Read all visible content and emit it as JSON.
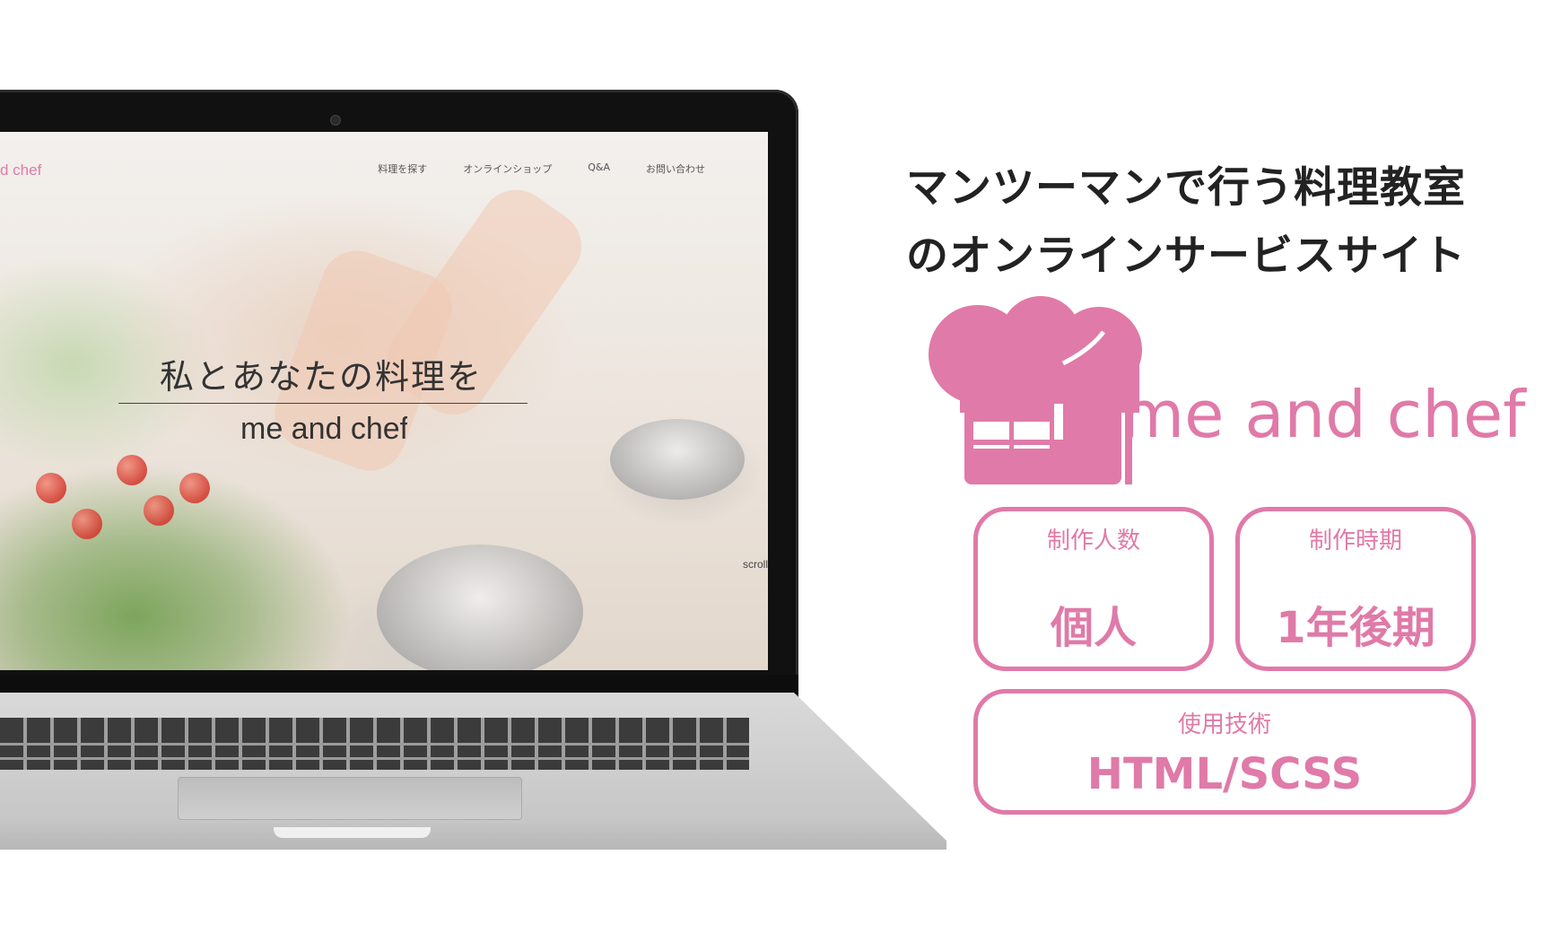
{
  "screen": {
    "brand_partial": "d chef",
    "nav_items": [
      "料理を探す",
      "オンラインショップ",
      "Q&A",
      "お問い合わせ"
    ],
    "hero_title": "私とあなたの料理を",
    "hero_subtitle": "me and chef",
    "scroll_label": "scroll"
  },
  "panel": {
    "headline_line1": "マンツーマンで行う料理教室",
    "headline_line2": "のオンラインサービスサイト",
    "logo_text": "me and chef",
    "team_size": {
      "label": "制作人数",
      "value": "個人"
    },
    "period": {
      "label": "制作時期",
      "value": "1年後期"
    },
    "tech": {
      "label": "使用技術",
      "value": "HTML/SCSS"
    }
  },
  "colors": {
    "accent": "#e07aa8",
    "text": "#222222"
  },
  "icons": [
    "chef-hat-house-logo-icon",
    "camera-icon"
  ]
}
